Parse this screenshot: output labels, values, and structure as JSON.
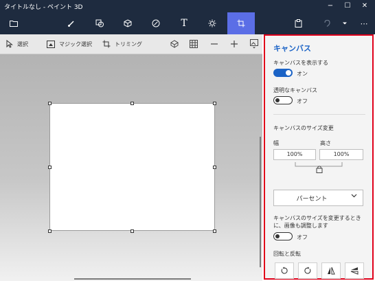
{
  "window": {
    "title": "タイトルなし - ペイント 3D",
    "minimize": "−",
    "maximize": "☐",
    "close": "✕"
  },
  "toolbar": {
    "items": [
      {
        "name": "menu",
        "icon": "folder-icon"
      },
      {
        "name": "brushes",
        "icon": "brush-icon"
      },
      {
        "name": "2d-shapes",
        "icon": "shapes-2d-icon"
      },
      {
        "name": "3d-shapes",
        "icon": "cube-icon"
      },
      {
        "name": "stickers",
        "icon": "sticker-icon"
      },
      {
        "name": "text",
        "icon": "text-icon"
      },
      {
        "name": "effects",
        "icon": "effects-icon"
      },
      {
        "name": "canvas",
        "icon": "canvas-crop-icon",
        "active": true
      },
      {
        "name": "paste",
        "icon": "paste-icon"
      },
      {
        "name": "undo",
        "icon": "undo-icon"
      },
      {
        "name": "history",
        "icon": "chevron-down-icon"
      },
      {
        "name": "more",
        "icon": "more-icon"
      }
    ],
    "text_tool_glyph": "T",
    "more_glyph": "⋯",
    "active_color": "#5b6ee6"
  },
  "subtoolbar": {
    "select_label": "選択",
    "magic_select_label": "マジック選択",
    "crop_label": "トリミング"
  },
  "panel": {
    "title": "キャンバス",
    "show_canvas_label": "キャンバスを表示する",
    "show_canvas_state": "オン",
    "transparent_label": "透明なキャンバス",
    "transparent_state": "オフ",
    "resize_label": "キャンバスのサイズ変更",
    "width_label": "幅",
    "height_label": "高さ",
    "width_value": "100%",
    "height_value": "100%",
    "unit_value": "パーセント",
    "resize_image_label": "キャンバスのサイズを変更するときに、画像も調整します",
    "resize_image_state": "オフ",
    "rotate_label": "回転と反転",
    "accent_color": "#1b63c6",
    "highlight_color": "#e0001a"
  }
}
